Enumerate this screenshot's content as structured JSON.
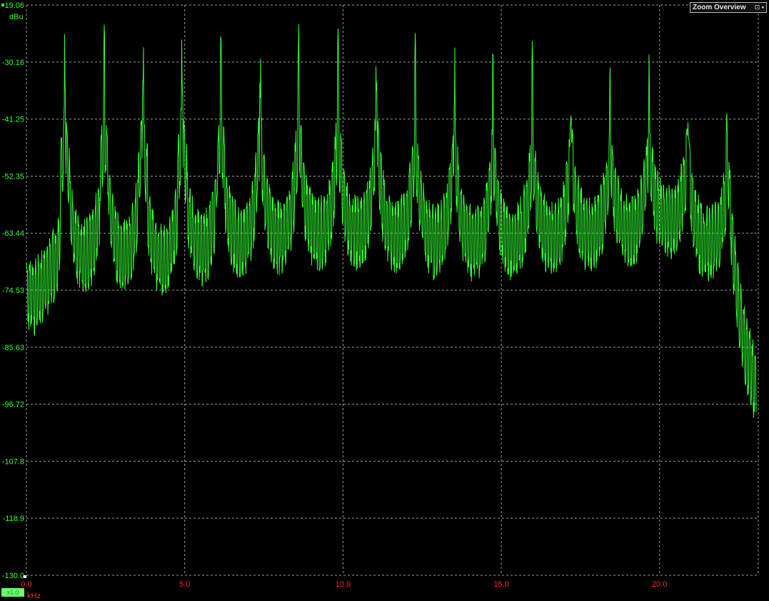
{
  "ui": {
    "zoom_overview_label": "Zoom Overview",
    "zoom_overview_icons": "⊡ ▪",
    "scale_box_label": "x1.0"
  },
  "colors": {
    "trace": "#33ff33",
    "grid": "#9a9a9a",
    "y_tick_text": "#33ff33",
    "x_tick_text": "#ff2222",
    "background": "#000000"
  },
  "chart_data": {
    "type": "line",
    "title": "",
    "xlabel": "kHz",
    "ylabel": "dBu",
    "xlim": [
      0.0,
      23.05
    ],
    "ylim": [
      -130.0,
      -19.06
    ],
    "x_ticks": [
      "0.0",
      "5.0",
      "10.0",
      "15.0",
      "20.0"
    ],
    "x_tick_values": [
      0.0,
      5.0,
      10.0,
      15.0,
      20.0
    ],
    "y_ticks": [
      "-19.06",
      "-30.16",
      "-41.25",
      "-52.35",
      "-63.44",
      "-74.53",
      "-85.63",
      "-96.72",
      "-107.8",
      "-118.9",
      "-130.0"
    ],
    "y_tick_values": [
      -19.06,
      -30.16,
      -41.25,
      -52.35,
      -63.44,
      -74.53,
      -85.63,
      -96.72,
      -107.8,
      -118.9,
      -130.0
    ],
    "grid": true,
    "series": [
      {
        "peaks_khz": [
          1.22,
          2.46,
          3.68,
          4.92,
          6.14,
          7.38,
          8.6,
          9.84,
          11.06,
          12.28,
          13.52,
          14.74,
          15.98,
          17.2,
          18.44,
          19.66,
          20.9,
          22.12
        ],
        "peaks_db": [
          -27.0,
          -27.3,
          -27.6,
          -27.3,
          -27.6,
          -28.8,
          -28.5,
          -28.8,
          -29.1,
          -30.3,
          -30.6,
          -32.4,
          -32.4,
          -33.3,
          -34.2,
          -33.9,
          -35.1,
          -45.6
        ],
        "valley_db": [
          -65.5,
          -68.5,
          -67.8,
          -69.2,
          -67.1,
          -65.8,
          -64.8,
          -64.3,
          -64.0,
          -64.5,
          -65.8,
          -66.1,
          -65.8,
          -65.1,
          -64.3,
          -63.8,
          -62.0,
          -66.0
        ],
        "envelope_x": [
          0.0,
          0.25,
          0.6,
          1.0,
          1.22
        ],
        "envelope_db": [
          -75.0,
          -76.0,
          -73.0,
          -68.0,
          -50.0
        ],
        "tail_x": [
          22.12,
          22.3,
          22.5,
          22.7,
          22.9,
          23.05
        ],
        "tail_db": [
          -45.6,
          -66.0,
          -78.0,
          -86.0,
          -90.0,
          -94.0
        ]
      }
    ]
  }
}
